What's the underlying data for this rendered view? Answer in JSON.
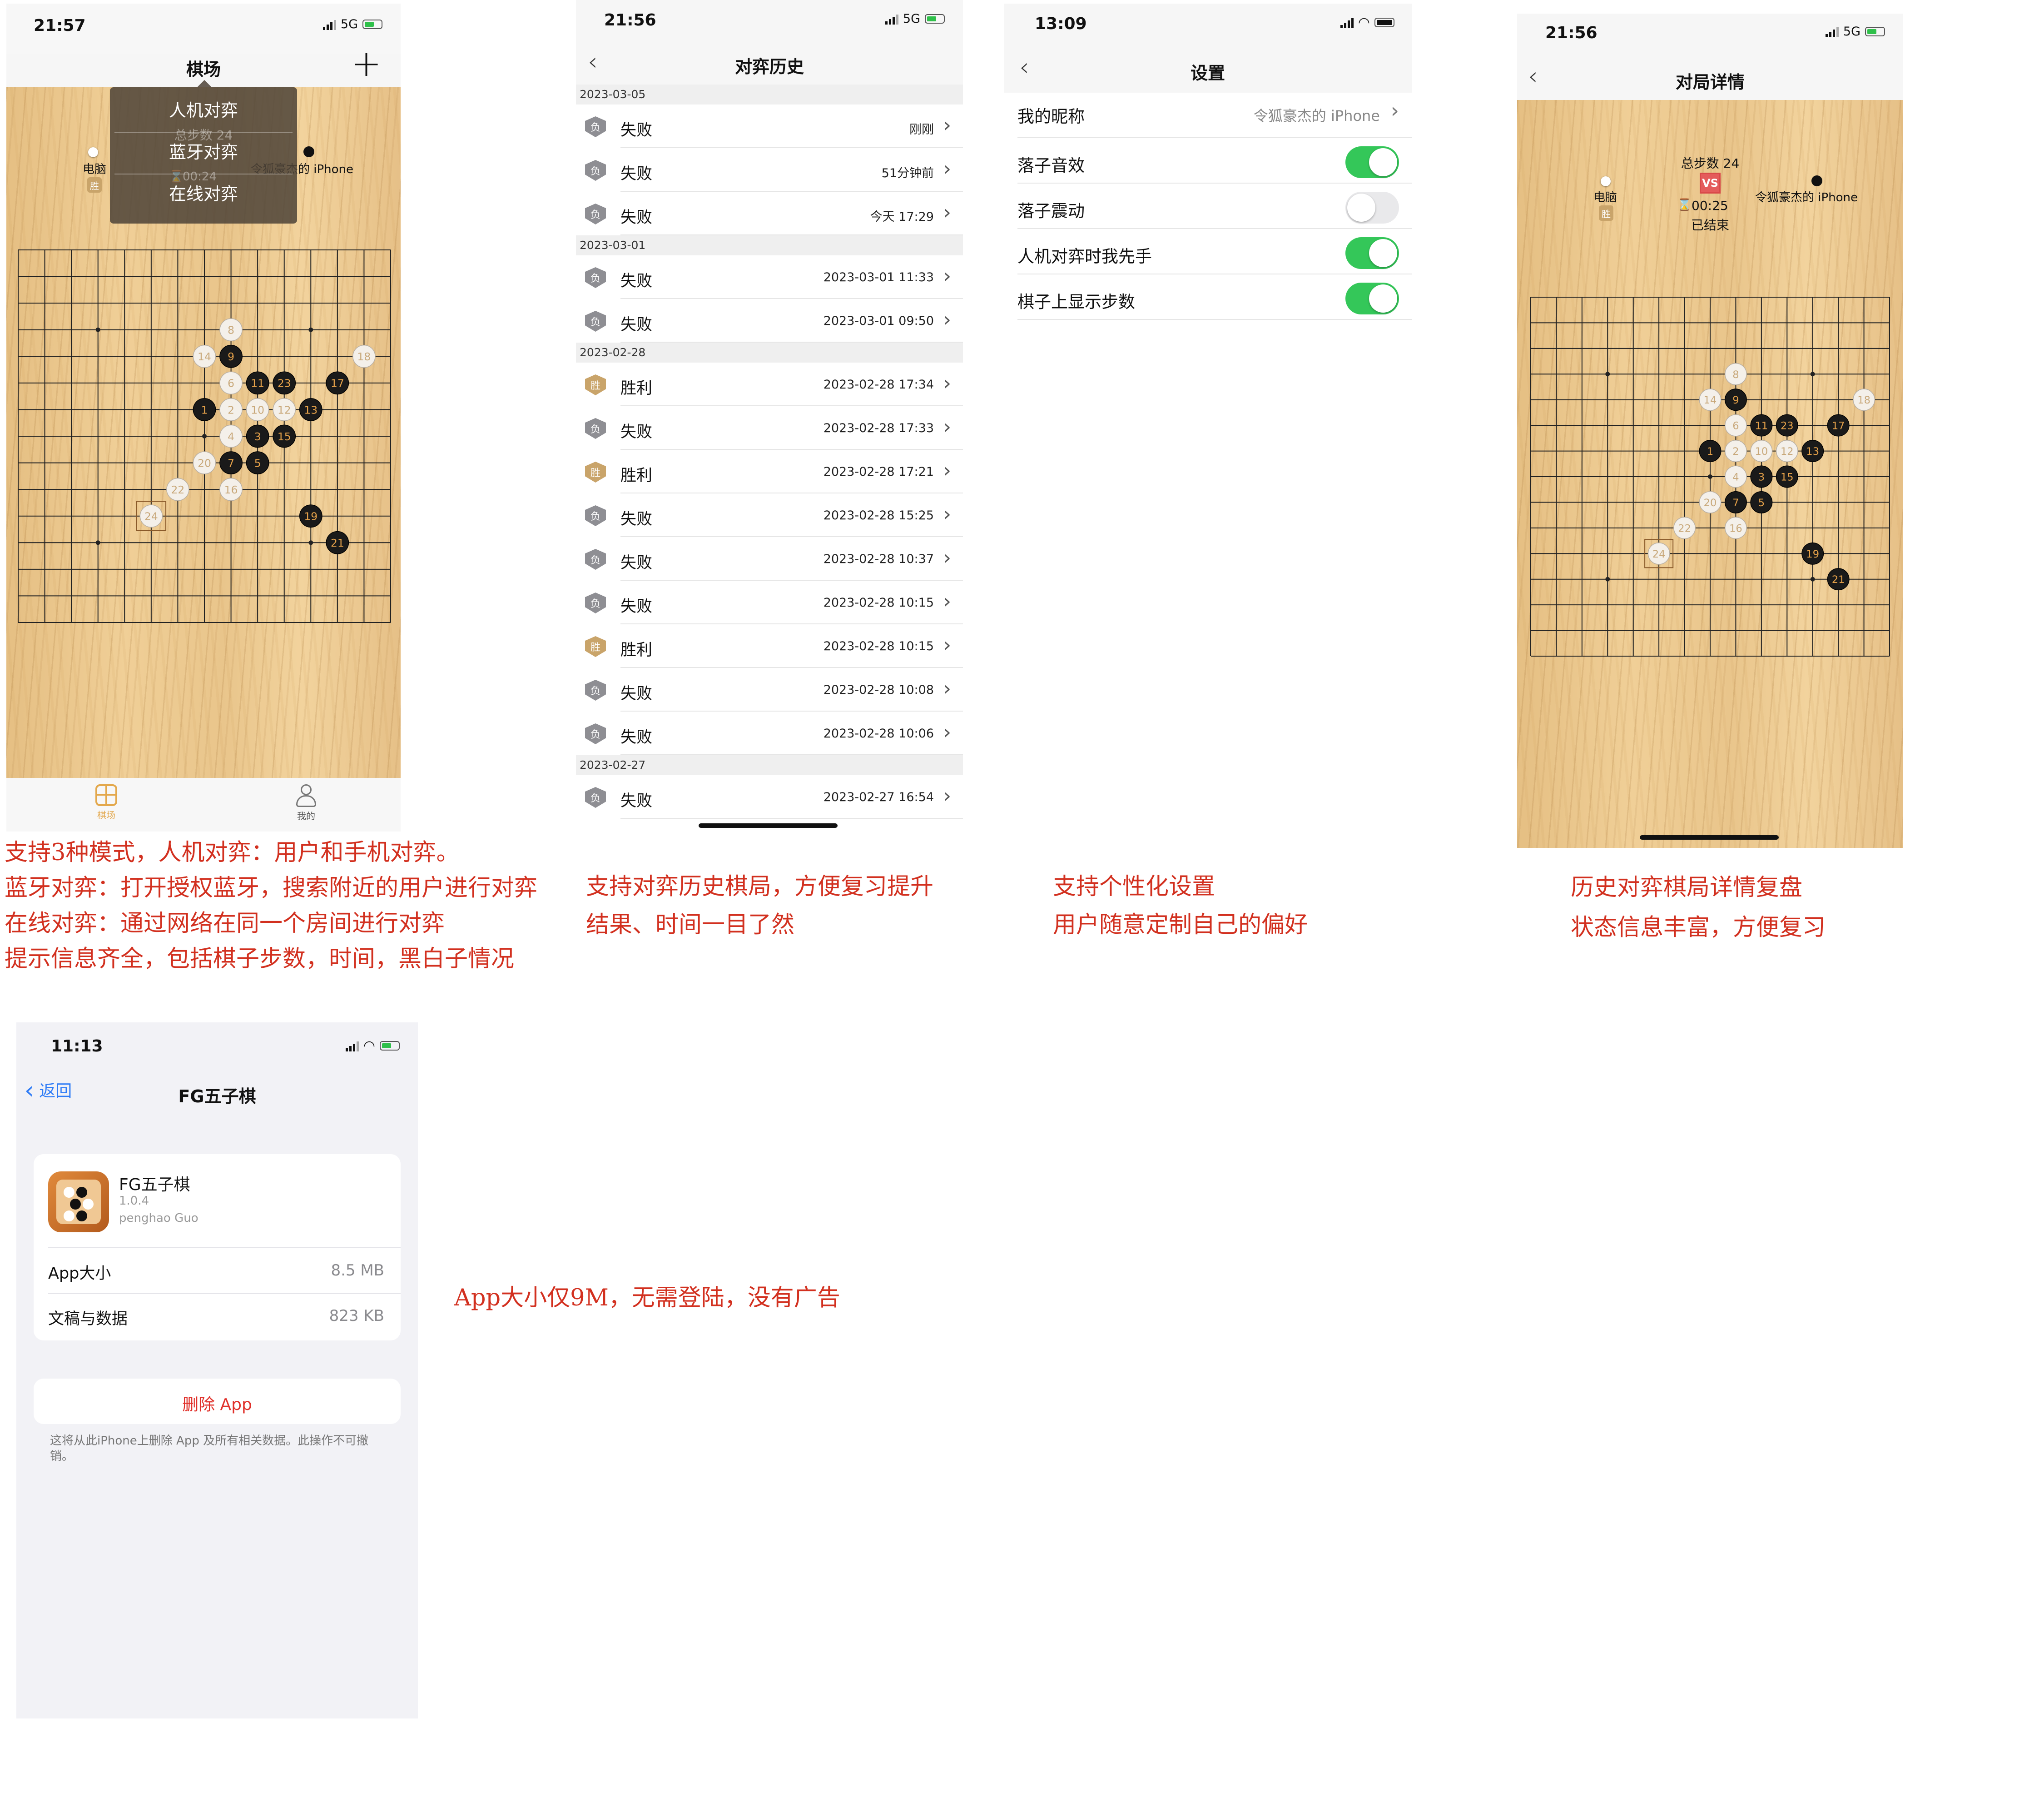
{
  "screens": {
    "game": {
      "status_time": "21:57",
      "network": "5G",
      "title": "棋场",
      "add_icon": "plus-icon",
      "menu": [
        "人机对弈",
        "蓝牙对弈",
        "在线对弈"
      ],
      "total_steps": "总步数 24",
      "computer_label": "电脑",
      "computer_badge": "胜",
      "player_label": "令狐豪杰的 iPhone",
      "timer": "00:24",
      "tabs": [
        {
          "label": "棋场",
          "icon": "board-icon",
          "active": true
        },
        {
          "label": "我的",
          "icon": "person-icon",
          "active": false
        }
      ]
    },
    "history": {
      "status_time": "21:56",
      "network": "5G",
      "title": "对弈历史",
      "sections": [
        {
          "date": "2023-03-05",
          "rows": [
            {
              "result": "失败",
              "badge": "负",
              "time": "刚刚"
            },
            {
              "result": "失败",
              "badge": "负",
              "time": "51分钟前"
            },
            {
              "result": "失败",
              "badge": "负",
              "time": "今天 17:29"
            }
          ]
        },
        {
          "date": "2023-03-01",
          "rows": [
            {
              "result": "失败",
              "badge": "负",
              "time": "2023-03-01 11:33"
            },
            {
              "result": "失败",
              "badge": "负",
              "time": "2023-03-01 09:50"
            }
          ]
        },
        {
          "date": "2023-02-28",
          "rows": [
            {
              "result": "胜利",
              "badge": "胜",
              "time": "2023-02-28 17:34"
            },
            {
              "result": "失败",
              "badge": "负",
              "time": "2023-02-28 17:33"
            },
            {
              "result": "胜利",
              "badge": "胜",
              "time": "2023-02-28 17:21"
            },
            {
              "result": "失败",
              "badge": "负",
              "time": "2023-02-28 15:25"
            },
            {
              "result": "失败",
              "badge": "负",
              "time": "2023-02-28 10:37"
            },
            {
              "result": "失败",
              "badge": "负",
              "time": "2023-02-28 10:15"
            },
            {
              "result": "胜利",
              "badge": "胜",
              "time": "2023-02-28 10:15"
            },
            {
              "result": "失败",
              "badge": "负",
              "time": "2023-02-28 10:08"
            },
            {
              "result": "失败",
              "badge": "负",
              "time": "2023-02-28 10:06"
            }
          ]
        },
        {
          "date": "2023-02-27",
          "rows": [
            {
              "result": "失败",
              "badge": "负",
              "time": "2023-02-27 16:54"
            }
          ]
        }
      ]
    },
    "settings": {
      "status_time": "13:09",
      "title": "设置",
      "nickname_label": "我的昵称",
      "nickname_value": "令狐豪杰的 iPhone",
      "toggles": [
        {
          "label": "落子音效",
          "on": true
        },
        {
          "label": "落子震动",
          "on": false
        },
        {
          "label": "人机对弈时我先手",
          "on": true
        },
        {
          "label": "棋子上显示步数",
          "on": true
        }
      ]
    },
    "detail": {
      "status_time": "21:56",
      "network": "5G",
      "title": "对局详情",
      "total_steps": "总步数 24",
      "vs": "VS",
      "computer_label": "电脑",
      "computer_badge": "胜",
      "player_label": "令狐豪杰的 iPhone",
      "timer": "00:25",
      "ended": "已结束"
    },
    "appinfo": {
      "status_time": "11:13",
      "back_label": "返回",
      "title": "FG五子棋",
      "app_name": "FG五子棋",
      "version": "1.0.4",
      "developer": "penghao Guo",
      "size_label": "App大小",
      "size_value": "8.5 MB",
      "docs_label": "文稿与数据",
      "docs_value": "823 KB",
      "delete_label": "删除 App",
      "delete_note": "这将从此iPhone上删除 App 及所有相关数据。此操作不可撤销。"
    }
  },
  "board_moves": [
    {
      "n": 1,
      "c": "b",
      "col": 7,
      "row": 6
    },
    {
      "n": 2,
      "c": "w",
      "col": 8,
      "row": 6
    },
    {
      "n": 3,
      "c": "b",
      "col": 9,
      "row": 7
    },
    {
      "n": 4,
      "c": "w",
      "col": 8,
      "row": 7
    },
    {
      "n": 5,
      "c": "b",
      "col": 9,
      "row": 8
    },
    {
      "n": 6,
      "c": "w",
      "col": 8,
      "row": 5
    },
    {
      "n": 7,
      "c": "b",
      "col": 8,
      "row": 8
    },
    {
      "n": 8,
      "c": "w",
      "col": 8,
      "row": 3
    },
    {
      "n": 9,
      "c": "b",
      "col": 8,
      "row": 4
    },
    {
      "n": 10,
      "c": "w",
      "col": 9,
      "row": 6
    },
    {
      "n": 11,
      "c": "b",
      "col": 9,
      "row": 5
    },
    {
      "n": 12,
      "c": "w",
      "col": 10,
      "row": 6
    },
    {
      "n": 13,
      "c": "b",
      "col": 11,
      "row": 6
    },
    {
      "n": 14,
      "c": "w",
      "col": 7,
      "row": 4
    },
    {
      "n": 15,
      "c": "b",
      "col": 10,
      "row": 7
    },
    {
      "n": 16,
      "c": "w",
      "col": 8,
      "row": 9
    },
    {
      "n": 17,
      "c": "b",
      "col": 12,
      "row": 5
    },
    {
      "n": 18,
      "c": "w",
      "col": 13,
      "row": 4
    },
    {
      "n": 19,
      "c": "b",
      "col": 11,
      "row": 10
    },
    {
      "n": 20,
      "c": "w",
      "col": 7,
      "row": 8
    },
    {
      "n": 21,
      "c": "b",
      "col": 12,
      "row": 11
    },
    {
      "n": 22,
      "c": "w",
      "col": 6,
      "row": 9
    },
    {
      "n": 23,
      "c": "b",
      "col": 10,
      "row": 5
    },
    {
      "n": 24,
      "c": "w",
      "col": 5,
      "row": 10
    }
  ],
  "captions": {
    "game": [
      "支持3种模式，人机对弈：用户和手机对弈。",
      "蓝牙对弈：打开授权蓝牙，搜索附近的用户进行对弈",
      "在线对弈：通过网络在同一个房间进行对弈",
      "提示信息齐全，包括棋子步数，时间，黑白子情况"
    ],
    "history": [
      "支持对弈历史棋局，方便复习提升",
      "结果、时间一目了然"
    ],
    "settings": [
      "支持个性化设置",
      "用户随意定制自己的偏好"
    ],
    "detail": [
      "历史对弈棋局详情复盘",
      "状态信息丰富，方便复习"
    ],
    "appinfo": [
      "App大小仅9M，无需登陆，没有广告"
    ]
  },
  "colors": {
    "accent": "#d2301f",
    "toggle_on": "#34c759",
    "win_badge": "#c9a46a",
    "lose_badge": "#8e8e93",
    "delete": "#e0302a"
  }
}
